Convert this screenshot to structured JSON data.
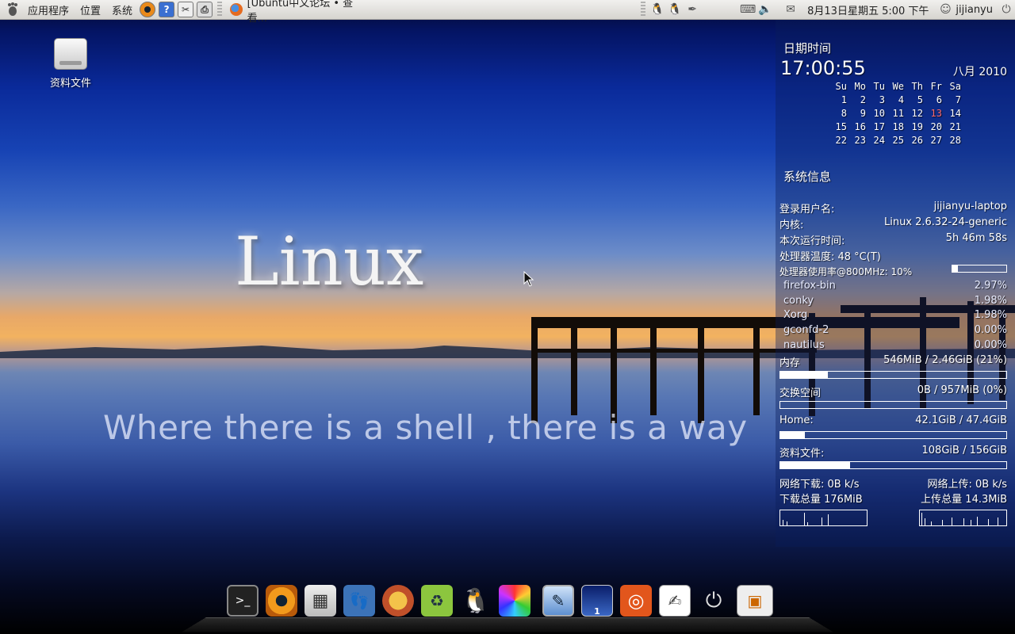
{
  "top_panel": {
    "menus": [
      "应用程序",
      "位置",
      "系统"
    ],
    "task_title": "[Ubuntu中文论坛 • 查看...",
    "clock": "8月13日星期五  5:00 下午",
    "username": "jijianyu"
  },
  "desktop": {
    "icon_label": "资料文件",
    "slogan_title": "Linux",
    "slogan_line": "Where there is a shell , there is a way"
  },
  "conky": {
    "date_heading": "日期时间",
    "time": "17:00:55",
    "month_year": "八月 2010",
    "weekdays": [
      "Su",
      "Mo",
      "Tu",
      "We",
      "Th",
      "Fr",
      "Sa"
    ],
    "weeks": [
      [
        "",
        "",
        "",
        "",
        "",
        "",
        ""
      ],
      [
        "1",
        "2",
        "3",
        "4",
        "5",
        "6",
        "7"
      ],
      [
        "8",
        "9",
        "10",
        "11",
        "12",
        "13",
        "14"
      ],
      [
        "15",
        "16",
        "17",
        "18",
        "19",
        "20",
        "21"
      ],
      [
        "22",
        "23",
        "24",
        "25",
        "26",
        "27",
        "28"
      ]
    ],
    "today": "13",
    "sys_heading": "系统信息",
    "user_label": "登录用户名:",
    "user_value": "jijianyu-laptop",
    "kernel_label": "内核:",
    "kernel_value": "Linux 2.6.32-24-generic",
    "uptime_label": "本次运行时间:",
    "uptime_value": "5h 46m 58s",
    "temp_label": "处理器温度:  48 °C(T)",
    "cpu_label": "处理器使用率@800MHz: 10%",
    "cpu_usage_fraction": 0.1,
    "processes": [
      {
        "name": "firefox-bin",
        "cpu": "2.97%"
      },
      {
        "name": "conky",
        "cpu": "1.98%"
      },
      {
        "name": "Xorg",
        "cpu": "1.98%"
      },
      {
        "name": "gconfd-2",
        "cpu": "0.00%"
      },
      {
        "name": "nautilus",
        "cpu": "0.00%"
      }
    ],
    "mem_label": "内存",
    "mem_value": "546MiB  / 2.46GiB (21%)",
    "mem_fraction": 0.21,
    "swap_label": "交换空间",
    "swap_value": "0B      / 957MiB  (0%)",
    "swap_fraction": 0.0,
    "home_label": "Home:",
    "home_value": "42.1GiB / 47.4GiB",
    "home_fraction": 0.11,
    "data_label": "资料文件:",
    "data_value": "108GiB  / 156GiB",
    "data_fraction": 0.31,
    "down_speed": "网络下载: 0B      k/s",
    "up_speed": "网络上传: 0B      k/s",
    "down_total": "下载总量 176MiB",
    "up_total": "上传总量 14.3MiB"
  },
  "dock": {
    "items": [
      "terminal-icon",
      "eye-icon",
      "calculator-icon",
      "gnome-foot-icon",
      "paint-brush-icon",
      "recycle-box-icon",
      "qq-penguin-icon",
      "color-wheel-icon",
      "desktop-edit-icon",
      "workspace-switcher-icon",
      "ubuntu-logo-icon",
      "text-editor-icon",
      "power-icon",
      "screenshot-icon"
    ],
    "workspace_number": "1"
  }
}
